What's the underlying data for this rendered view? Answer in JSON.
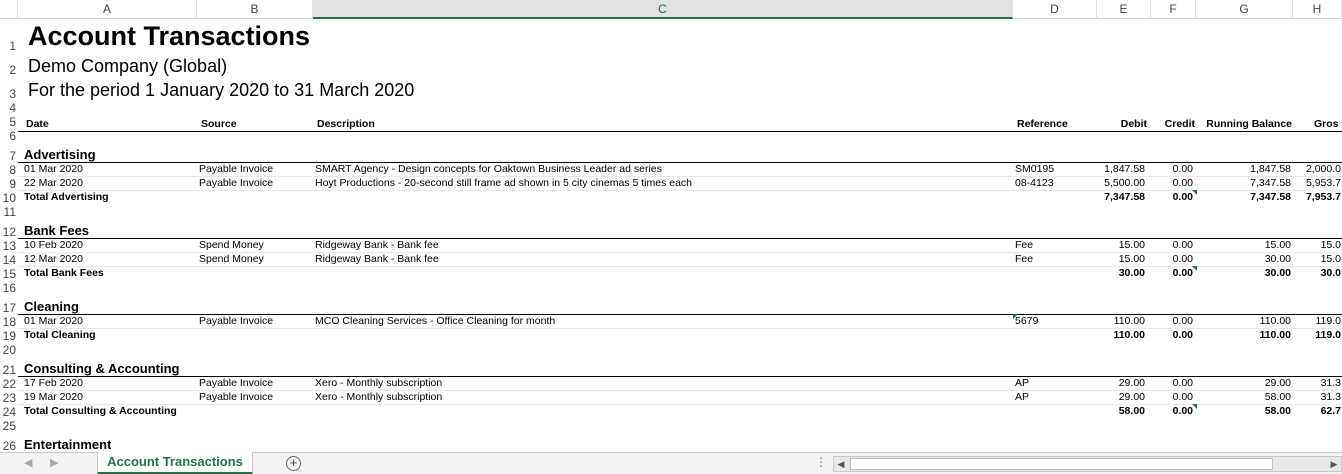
{
  "columns": [
    "A",
    "B",
    "C",
    "D",
    "E",
    "F",
    "G",
    "H"
  ],
  "sheet": {
    "title": "Account Transactions",
    "company": "Demo Company (Global)",
    "period": "For the period 1 January 2020 to 31 March 2020",
    "headers": {
      "date": "Date",
      "source": "Source",
      "description": "Description",
      "reference": "Reference",
      "debit": "Debit",
      "credit": "Credit",
      "running_balance": "Running Balance",
      "gross": "Gros"
    },
    "sections": [
      {
        "name": "Advertising",
        "rows": [
          {
            "date": "01 Mar 2020",
            "source": "Payable Invoice",
            "description": "SMART Agency - Design concepts for Oaktown Business Leader ad series",
            "reference": "SM0195",
            "debit": "1,847.58",
            "credit": "0.00",
            "balance": "1,847.58",
            "gross": "2,000.0"
          },
          {
            "date": "22 Mar 2020",
            "source": "Payable Invoice",
            "description": "Hoyt Productions - 20-second still frame ad shown in 5 city cinemas 5 times each",
            "reference": "08-4123",
            "debit": "5,500.00",
            "credit": "0.00",
            "balance": "7,347.58",
            "gross": "5,953.7"
          }
        ],
        "total": {
          "label": "Total Advertising",
          "debit": "7,347.58",
          "credit": "0.00",
          "balance": "7,347.58",
          "gross": "7,953.7"
        }
      },
      {
        "name": "Bank Fees",
        "rows": [
          {
            "date": "10 Feb 2020",
            "source": "Spend Money",
            "description": "Ridgeway Bank - Bank fee",
            "reference": "Fee",
            "debit": "15.00",
            "credit": "0.00",
            "balance": "15.00",
            "gross": "15.0"
          },
          {
            "date": "12 Mar 2020",
            "source": "Spend Money",
            "description": "Ridgeway Bank - Bank fee",
            "reference": "Fee",
            "debit": "15.00",
            "credit": "0.00",
            "balance": "30.00",
            "gross": "15.0"
          }
        ],
        "total": {
          "label": "Total Bank Fees",
          "debit": "30.00",
          "credit": "0.00",
          "balance": "30.00",
          "gross": "30.0"
        }
      },
      {
        "name": "Cleaning",
        "rows": [
          {
            "date": "01 Mar 2020",
            "source": "Payable Invoice",
            "description": "MCO Cleaning Services - Office Cleaning for month",
            "reference": "5679",
            "debit": "110.00",
            "credit": "0.00",
            "balance": "110.00",
            "gross": "119.0"
          }
        ],
        "total": {
          "label": "Total Cleaning",
          "debit": "110.00",
          "credit": "0.00",
          "balance": "110.00",
          "gross": "119.0"
        }
      },
      {
        "name": "Consulting & Accounting",
        "rows": [
          {
            "date": "17 Feb 2020",
            "source": "Payable Invoice",
            "description": "Xero - Monthly subscription",
            "reference": "AP",
            "debit": "29.00",
            "credit": "0.00",
            "balance": "29.00",
            "gross": "31.3"
          },
          {
            "date": "19 Mar 2020",
            "source": "Payable Invoice",
            "description": "Xero - Monthly subscription",
            "reference": "AP",
            "debit": "29.00",
            "credit": "0.00",
            "balance": "58.00",
            "gross": "31.3"
          }
        ],
        "total": {
          "label": "Total Consulting & Accounting",
          "debit": "58.00",
          "credit": "0.00",
          "balance": "58.00",
          "gross": "62.7"
        }
      },
      {
        "name": "Entertainment",
        "rows": [],
        "total": null
      }
    ]
  },
  "tabs": {
    "active_label": "Account Transactions",
    "add_label": "+",
    "prev_arrow": "◀",
    "next_arrow": "▶",
    "dots": "⋮"
  },
  "colors": {
    "accent": "#217346"
  }
}
